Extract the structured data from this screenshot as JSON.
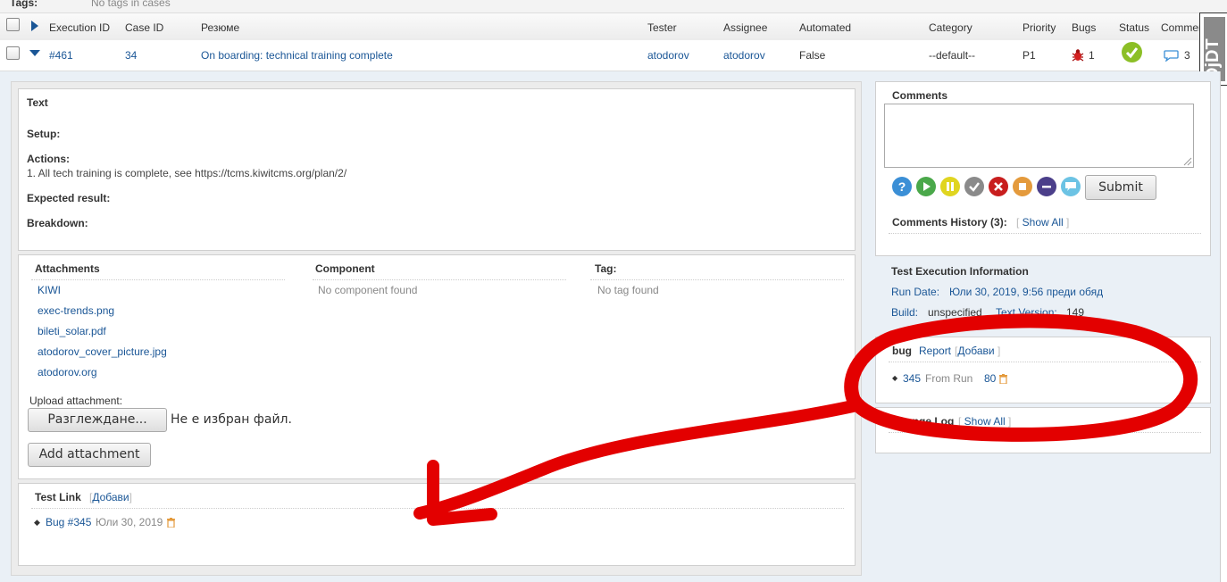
{
  "tags_row": {
    "label": "Tags:",
    "value": "No tags in cases"
  },
  "columns": [
    "Execution ID",
    "Case ID",
    "Резюме",
    "Tester",
    "Assignee",
    "Automated",
    "Category",
    "Priority",
    "Bugs",
    "Status",
    "Comments"
  ],
  "execution": {
    "id": "#461",
    "case_id": "34",
    "summary": "On boarding: technical training complete",
    "tester": "atodorov",
    "assignee": "atodorov",
    "automated": "False",
    "category": "--default--",
    "priority": "P1",
    "bugs": "1",
    "comments": "3"
  },
  "badge": "DjDT",
  "text_panel": {
    "title": "Text",
    "setup_label": "Setup:",
    "actions_label": "Actions:",
    "actions_text": "1. All tech training is complete, see https://tcms.kiwitcms.org/plan/2/",
    "expected_label": "Expected result:",
    "breakdown_label": "Breakdown:"
  },
  "attachments": {
    "title": "Attachments",
    "files": [
      "KIWI",
      "exec-trends.png",
      "bileti_solar.pdf",
      "atodorov_cover_picture.jpg",
      "atodorov.org"
    ],
    "upload_label": "Upload attachment:",
    "browse_button": "Разглеждане...",
    "no_file": "Не е избран файл.",
    "add_button": "Add attachment"
  },
  "component": {
    "title": "Component",
    "empty": "No component found"
  },
  "tag": {
    "title": "Tag:",
    "empty": "No tag found"
  },
  "test_link": {
    "title": "Test Link",
    "add": "Добави",
    "item_link": "Bug #345",
    "item_date": "Юли 30, 2019"
  },
  "comments": {
    "title": "Comments",
    "submit": "Submit",
    "history_label": "Comments History (3):",
    "show_all": "Show All",
    "status_icons": [
      "help-icon",
      "play-icon",
      "pause-icon",
      "check-icon",
      "x-icon",
      "stop-icon",
      "minus-icon",
      "comment-icon"
    ]
  },
  "exec_info": {
    "title": "Test Execution Information",
    "run_date_label": "Run Date:",
    "run_date": "Юли 30, 2019, 9:56 преди обяд",
    "build_label": "Build:",
    "build": "unspecified",
    "text_version_label": "Text Version:",
    "text_version": "149"
  },
  "bug_panel": {
    "title": "bug",
    "report": "Report",
    "add": "Добави",
    "bug_id": "345",
    "from_run": "From Run",
    "run_id": "80"
  },
  "change_log": {
    "title": "Change Log",
    "show_all": "Show All"
  },
  "colors": {
    "link": "#1a5696",
    "annotation": "#e30000",
    "status_pass": "#8cbf26"
  }
}
